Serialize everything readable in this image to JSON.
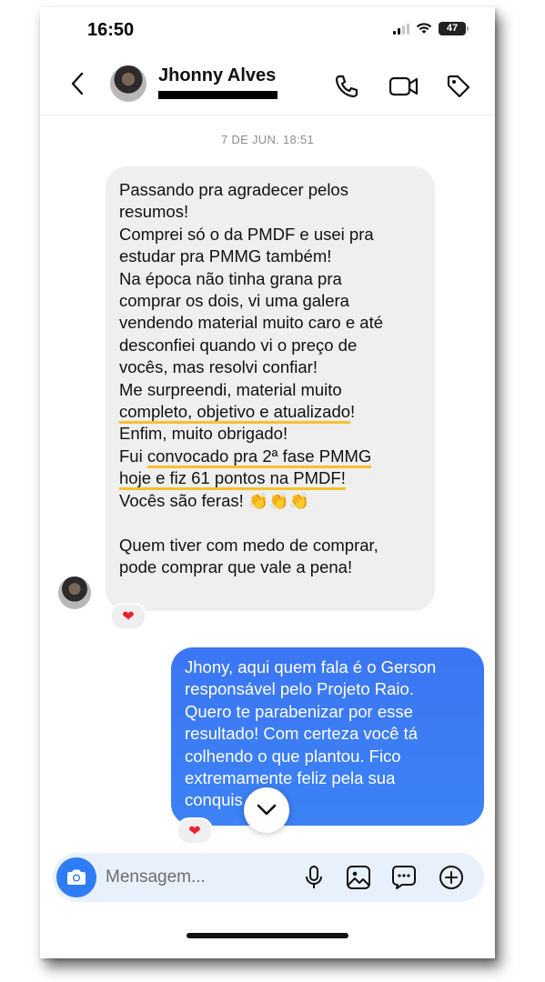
{
  "status_bar": {
    "time": "16:50",
    "battery": "47"
  },
  "header": {
    "contact_name": "Jhonny Alves"
  },
  "thread": {
    "timestamp": "7 DE JUN. 18:51",
    "incoming": {
      "lines": [
        "Passando pra agradecer pelos\nresumos!",
        "Comprei só o da PMDF e usei pra\nestudar pra PMMG também!",
        "Na época não tinha grana pra\ncomprar os dois, vi uma galera\nvendendo material muito caro e até\ndesconfiei quando vi o preço de\nvocês, mas resolvi confiar!",
        "Me surpreendi, material muito"
      ],
      "highlight1": "completo, objetivo e atualizado",
      "after_highlight1": "!",
      "line_enfim": "Enfim, muito obrigado!",
      "fui_prefix": "Fui ",
      "highlight2a": "convocado pra 2ª fase PMMG",
      "highlight2b": "hoje e fiz 61 pontos na PMDF!",
      "feras": "Vocês são feras! ",
      "claps": "👏👏👏",
      "closing": "Quem tiver com medo de comprar,\npode comprar que vale a pena!",
      "reaction": "❤"
    },
    "outgoing": {
      "text": "Jhony, aqui quem fala é o Gerson\nresponsável pelo Projeto Raio.\nQuero te parabenizar por esse\nresultado! Com certeza você tá\ncolhendo o que plantou. Fico\nextremamente feliz pela sua\nconquis",
      "reaction": "❤"
    }
  },
  "composer": {
    "placeholder": "Mensagem..."
  },
  "colors": {
    "accent": "#3b7cf5",
    "highlight": "#f7c12d",
    "reaction": "#e8202e"
  }
}
